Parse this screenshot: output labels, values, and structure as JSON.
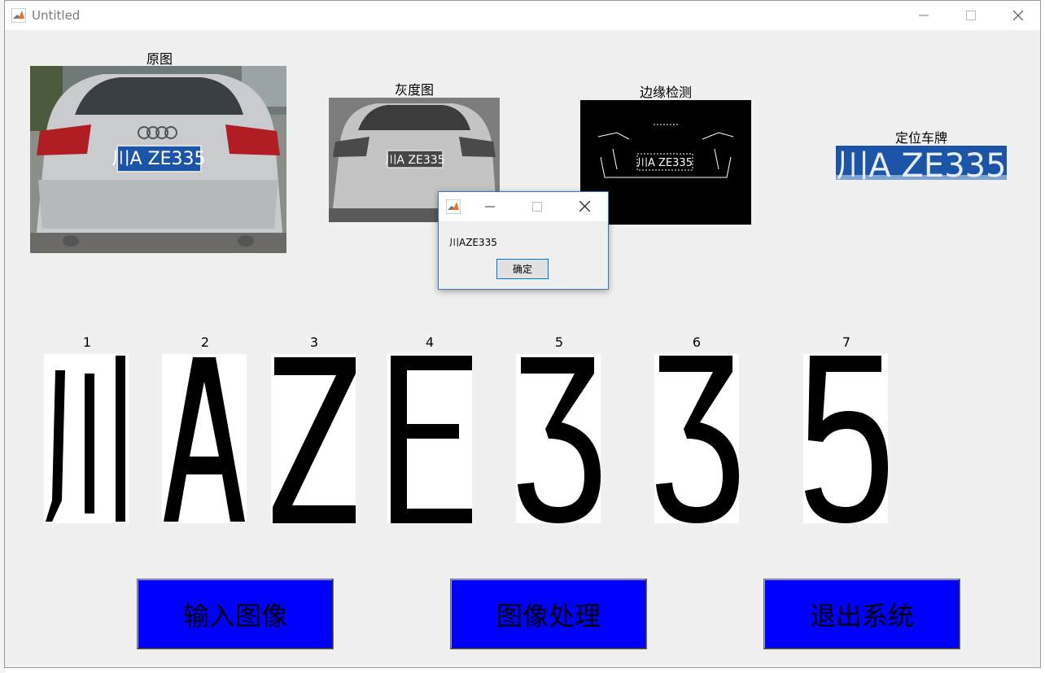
{
  "window": {
    "title": "Untitled",
    "icon": "matlab-icon",
    "controls": [
      "minimize-icon",
      "maximize-icon",
      "close-icon"
    ]
  },
  "panels": {
    "original": {
      "caption": "原图"
    },
    "gray": {
      "caption": "灰度图"
    },
    "edge": {
      "caption": "边缘检测"
    },
    "plate": {
      "caption": "定位车牌"
    }
  },
  "plate_text": {
    "province": "川A",
    "rest": "ZE335",
    "full": "川A ZE335"
  },
  "characters": [
    {
      "index": "1",
      "glyph": "川"
    },
    {
      "index": "2",
      "glyph": "A"
    },
    {
      "index": "3",
      "glyph": "Z"
    },
    {
      "index": "4",
      "glyph": "E"
    },
    {
      "index": "5",
      "glyph": "3"
    },
    {
      "index": "6",
      "glyph": "3"
    },
    {
      "index": "7",
      "glyph": "5"
    }
  ],
  "buttons": {
    "input": "输入图像",
    "process": "图像处理",
    "exit": "退出系统"
  },
  "dialog": {
    "message": "川AZE335",
    "ok_label": "确定"
  },
  "colors": {
    "button_bg": "#0000ff",
    "figure_bg": "#f0f0f0",
    "plate_blue": "#1c55a8"
  }
}
